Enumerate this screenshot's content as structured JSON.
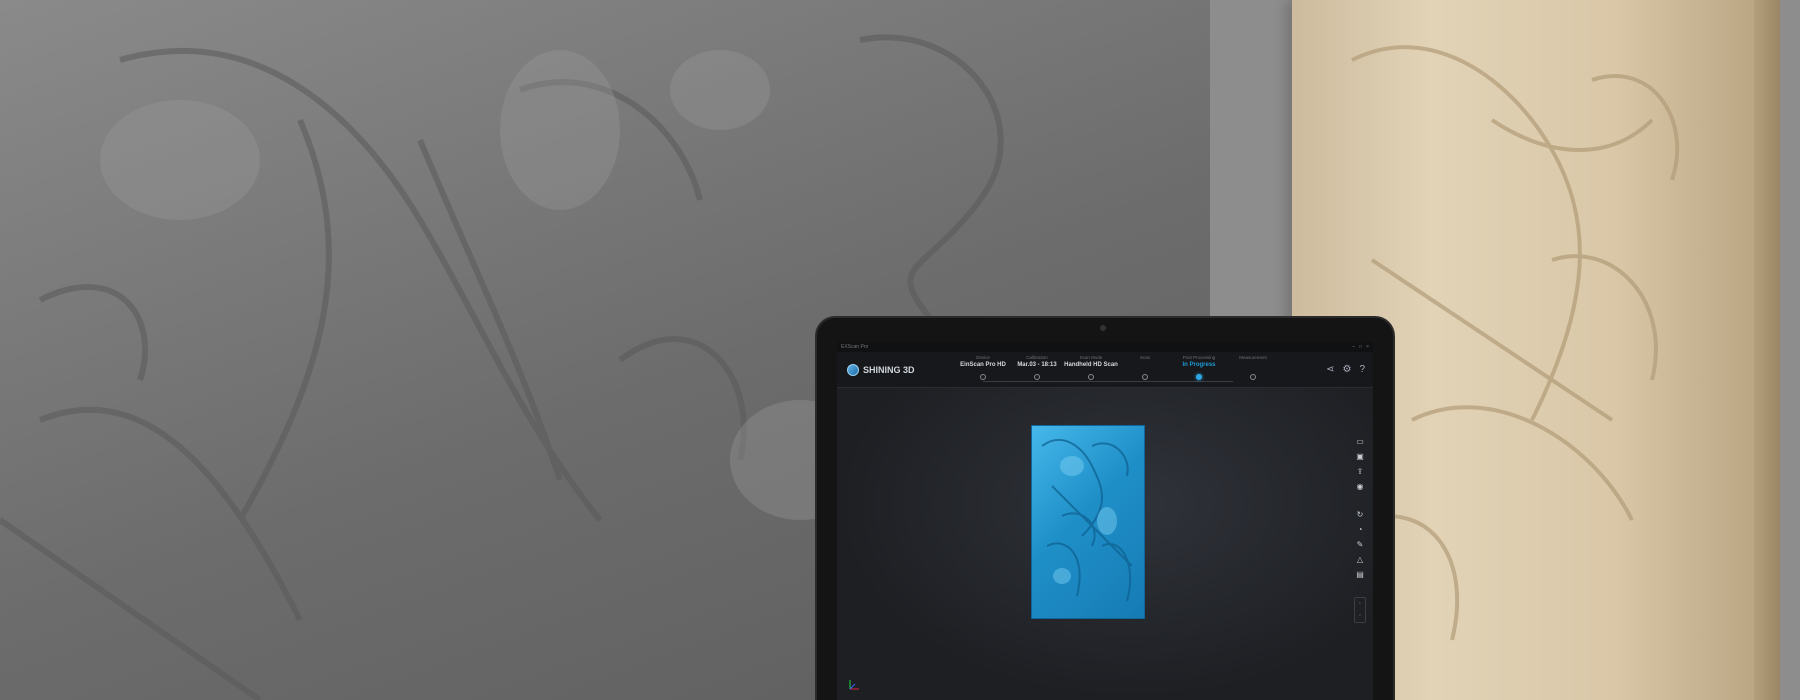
{
  "app": {
    "window_title": "EXScan Pro",
    "brand": "SHINING 3D"
  },
  "steps": [
    {
      "label": "Device",
      "value": "EinScan Pro HD",
      "active": false
    },
    {
      "label": "Calibration",
      "value": "Mar.03 - 18:13",
      "active": false
    },
    {
      "label": "Scan Mode",
      "value": "Handheld HD Scan",
      "active": false
    },
    {
      "label": "Scan",
      "value": "",
      "active": false
    },
    {
      "label": "Post Processing",
      "value": "In Progress",
      "active": true
    },
    {
      "label": "Measurement",
      "value": "",
      "active": false
    }
  ],
  "header_icons": [
    "share-icon",
    "settings-icon",
    "help-icon"
  ],
  "toolbar_icons": [
    "folder-icon",
    "save-icon",
    "export-icon",
    "check-icon",
    "undo-icon",
    "fill-holes-icon",
    "edit-icon",
    "warning-icon",
    "layers-icon"
  ],
  "colors": {
    "accent": "#1e9ad6",
    "model": "#2a9fd8",
    "background": "#1d1f23"
  }
}
